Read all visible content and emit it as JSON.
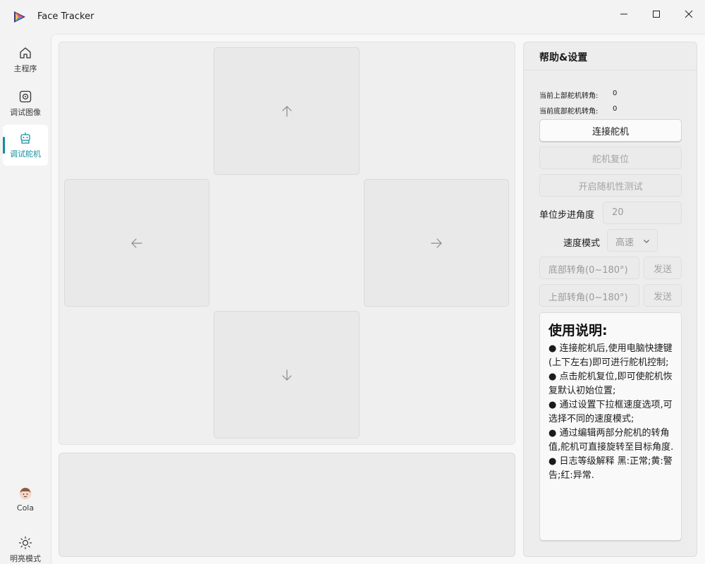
{
  "app": {
    "title": "Face Tracker"
  },
  "nav": {
    "items": [
      {
        "label": "主程序",
        "icon": "home-icon"
      },
      {
        "label": "调试图像",
        "icon": "camera-icon"
      },
      {
        "label": "调试舵机",
        "icon": "robot-icon",
        "active": true
      }
    ],
    "user": {
      "label": "Cola",
      "icon": "avatar-icon"
    },
    "theme": {
      "label": "明亮模式",
      "icon": "sun-icon"
    }
  },
  "dpad": {
    "up_icon": "arrow-up-icon",
    "down_icon": "arrow-down-icon",
    "left_icon": "arrow-left-icon",
    "right_icon": "arrow-right-icon"
  },
  "log": {
    "text": ""
  },
  "panel": {
    "title": "帮助&设置",
    "top_angle_label": "当前上部舵机转角:",
    "top_angle_value": "0",
    "bottom_angle_label": "当前底部舵机转角:",
    "bottom_angle_value": "0",
    "connect_label": "连接舵机",
    "reset_label": "舵机复位",
    "random_test_label": "开启随机性测试",
    "step_label": "单位步进角度",
    "step_value": "20",
    "speed_label": "速度模式",
    "speed_value": "高速",
    "bottom_angle_placeholder": "底部转角(0~180°)",
    "top_angle_placeholder": "上部转角(0~180°)",
    "send_label": "发送",
    "help_heading": "使用说明:",
    "help_items": [
      "● 连接舵机后,使用电脑快捷键(上下左右)即可进行舵机控制;",
      "● 点击舵机复位,即可使舵机恢复默认初始位置;",
      "● 通过设置下拉框速度选项,可选择不同的速度模式;",
      "● 通过编辑两部分舵机的转角值,舵机可直接旋转至目标角度.",
      "● 日志等级解释 黑:正常;黄:警告;红:异常."
    ]
  },
  "colors": {
    "accent": "#0f8f9f",
    "disabled_text": "#a4a4a4"
  }
}
